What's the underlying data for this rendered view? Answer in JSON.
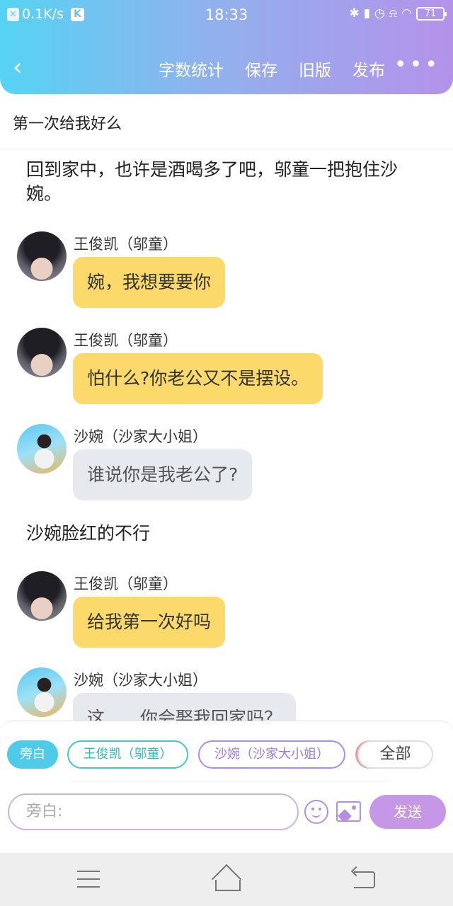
{
  "status_bar": {
    "net_speed": "0.1K/s",
    "time": "18:33",
    "battery": "71"
  },
  "header": {
    "actions": [
      "字数统计",
      "保存",
      "旧版",
      "发布"
    ],
    "more": "•••"
  },
  "document": {
    "title": "第一次给我好么"
  },
  "story": {
    "narration_1": "回到家中，也许是酒喝多了吧，邬童一把抱住沙婉。",
    "messages": [
      {
        "speaker": "王俊凯（邬童）",
        "text": "婉，我想要要你"
      },
      {
        "speaker": "王俊凯（邬童）",
        "text": "怕什么?你老公又不是摆设。"
      },
      {
        "speaker": "沙婉（沙家大小姐）",
        "text": "谁说你是我老公了?"
      }
    ],
    "narration_2": "沙婉脸红的不行",
    "messages_2": [
      {
        "speaker": "王俊凯（邬童）",
        "text": "给我第一次好吗"
      },
      {
        "speaker": "沙婉（沙家大小姐）",
        "text": "这……你会娶我回家吗？"
      }
    ]
  },
  "role_bar": {
    "narrator": "旁白",
    "role_a": "王俊凯（邬童）",
    "role_b": "沙婉（沙家大小姐）",
    "all": "全部"
  },
  "composer": {
    "placeholder": "旁白:",
    "send_label": "发送"
  },
  "colors": {
    "header_gradient": [
      "#56d3f3",
      "#b592ea"
    ],
    "bubble_yellow": "#fbd96a",
    "bubble_gray": "#e6eaee",
    "accent_purple": "#c597e6"
  }
}
